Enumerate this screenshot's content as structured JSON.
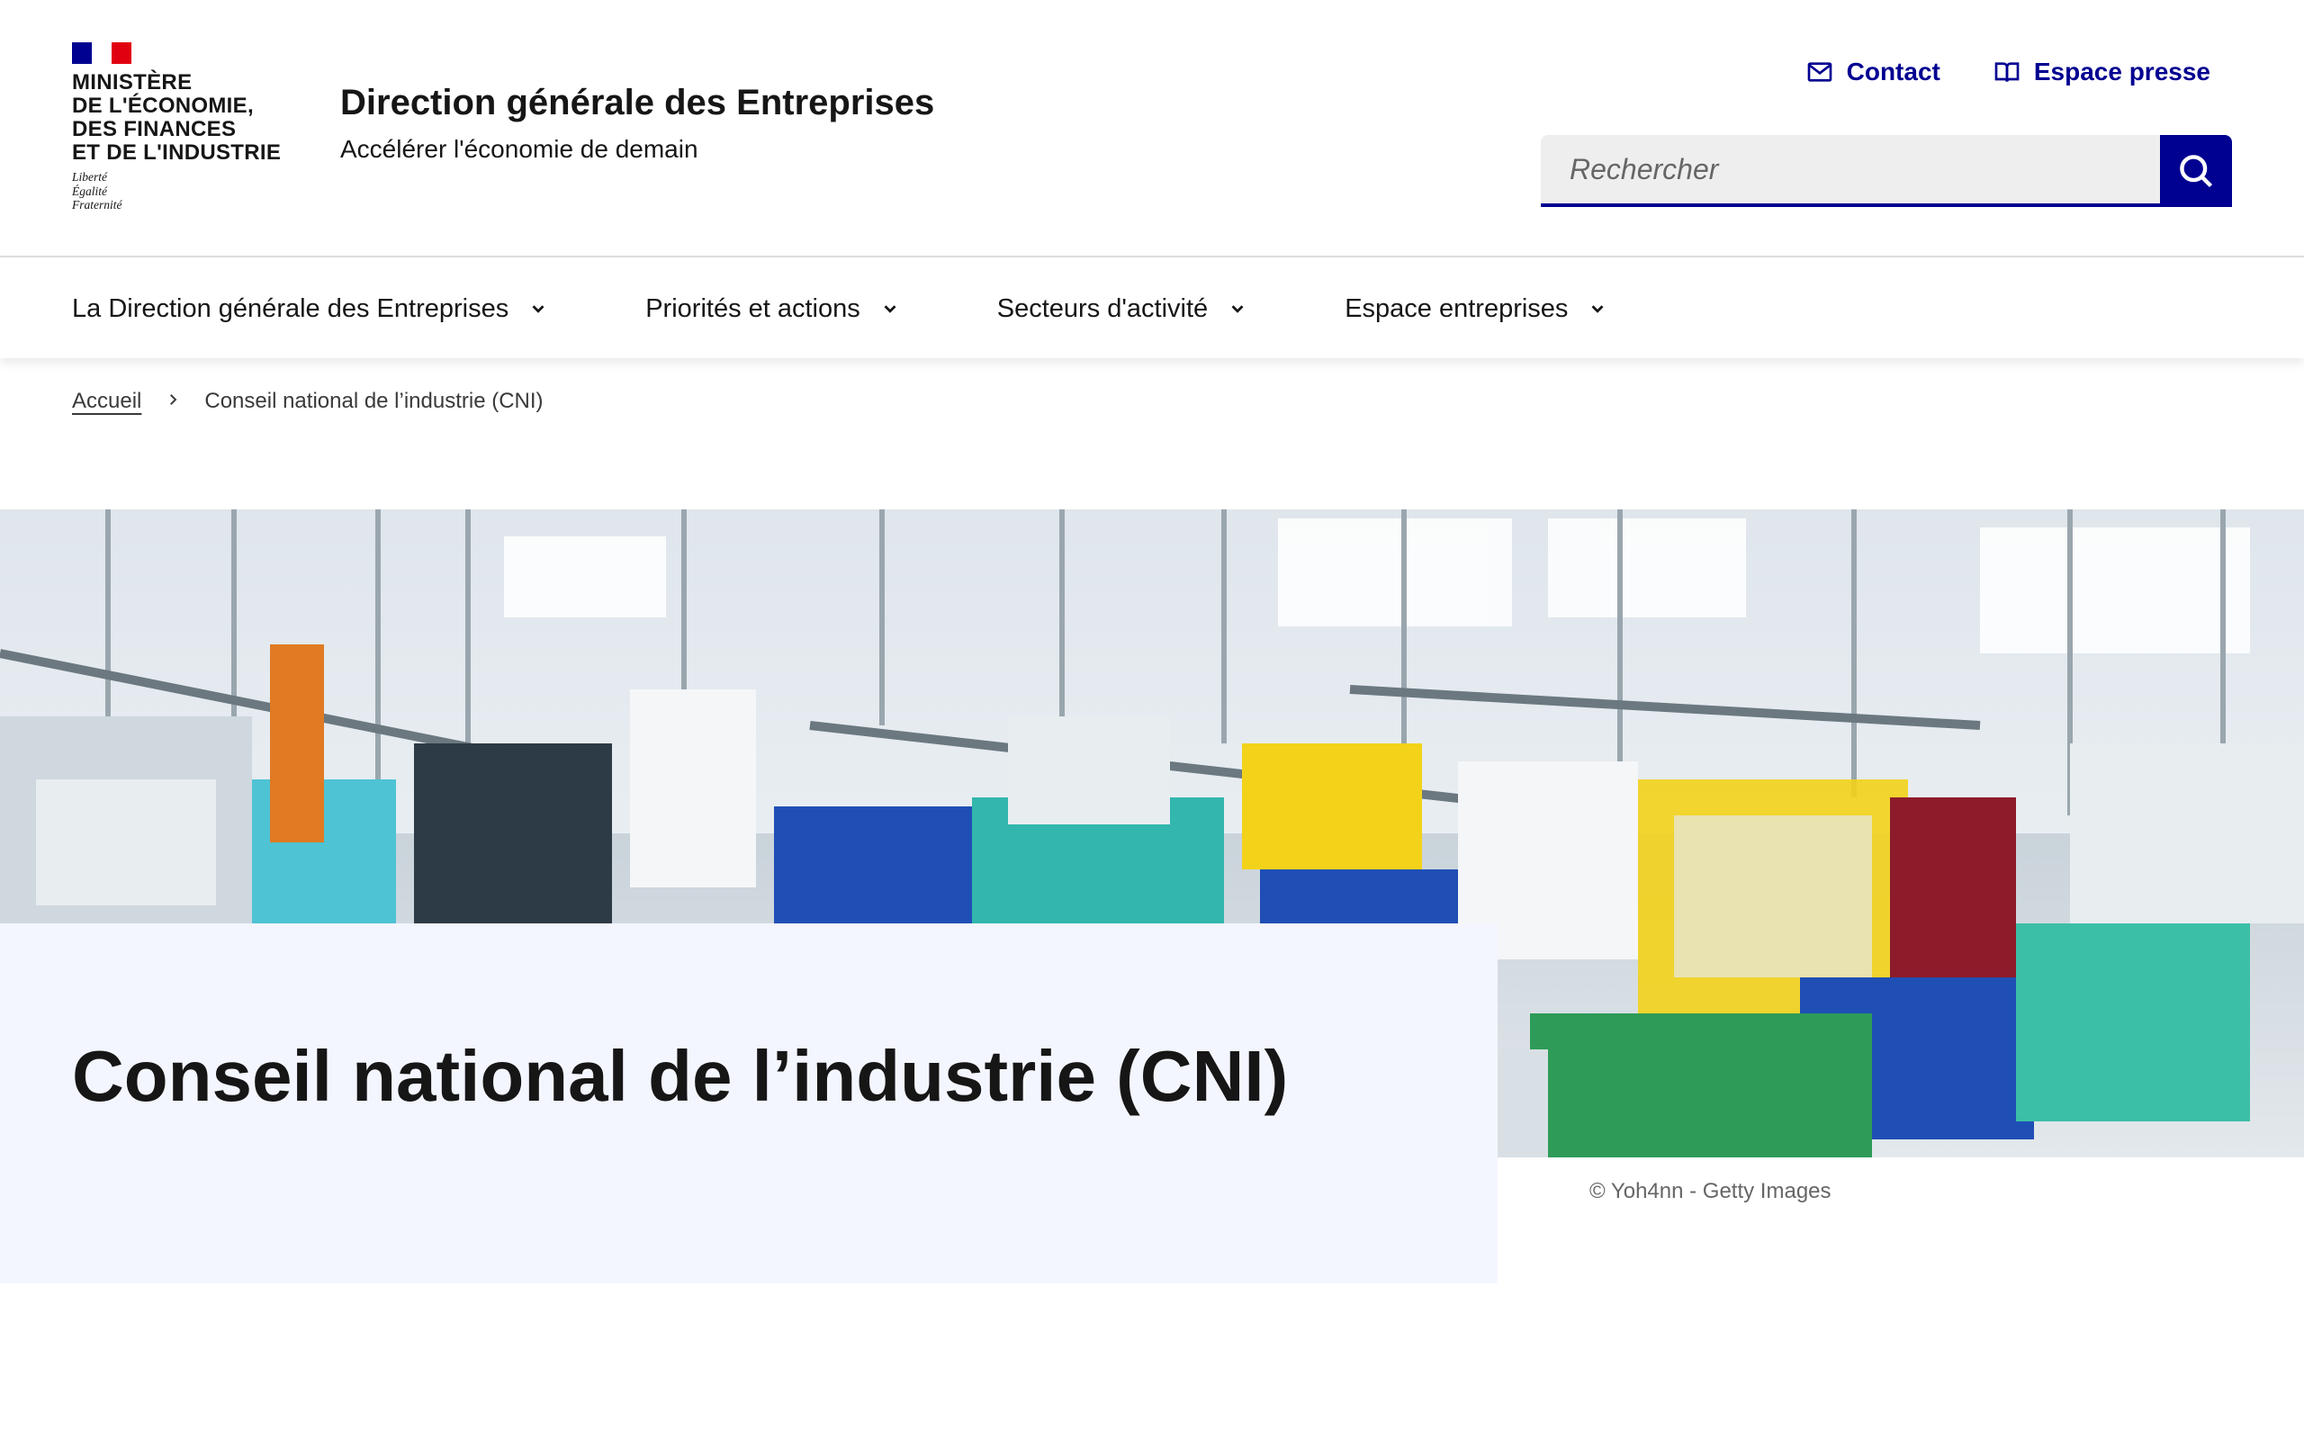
{
  "header": {
    "logo": {
      "ministry": "MINISTÈRE\nDE L'ÉCONOMIE,\nDES FINANCES\nET DE L'INDUSTRIE",
      "motto": "Liberté\nÉgalité\nFraternité",
      "flag_colors": [
        "#000091",
        "#ffffff",
        "#e1000f"
      ]
    },
    "site_title": "Direction générale des Entreprises",
    "site_tagline": "Accélérer l'économie de demain",
    "quick_links": [
      {
        "label": "Contact",
        "icon": "mail-icon"
      },
      {
        "label": "Espace presse",
        "icon": "book-icon"
      }
    ],
    "search": {
      "placeholder": "Rechercher",
      "value": "",
      "button_icon": "search-icon"
    }
  },
  "nav": {
    "items": [
      {
        "label": "La Direction générale des Entreprises",
        "icon": "chevron-down-icon"
      },
      {
        "label": "Priorités et actions",
        "icon": "chevron-down-icon"
      },
      {
        "label": "Secteurs d'activité",
        "icon": "chevron-down-icon"
      },
      {
        "label": "Espace entreprises",
        "icon": "chevron-down-icon"
      }
    ]
  },
  "breadcrumb": {
    "items": [
      {
        "label": "Accueil"
      },
      {
        "label": "Conseil national de l’industrie (CNI)"
      }
    ],
    "separator_icon": "chevron-right-icon"
  },
  "hero": {
    "image_description_icon": "factory-photo",
    "title": "Conseil national de l’industrie (CNI)",
    "credit": "© Yoh4nn - Getty Images"
  },
  "colors": {
    "accent": "#000091",
    "hero_panel_bg": "#f4f6ff",
    "text": "#161616"
  }
}
